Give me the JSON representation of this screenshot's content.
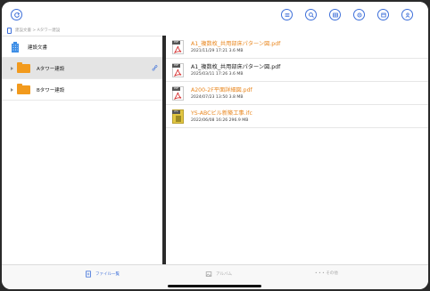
{
  "toolbar": {
    "left_button_icon": "refresh-icon",
    "right_buttons": [
      "list-icon",
      "search-icon",
      "grid-icon",
      "settings-icon",
      "window-icon",
      "user-icon"
    ],
    "accent": "#3d6fd9"
  },
  "breadcrumb": {
    "text": "建設文書 > Aタワー建設"
  },
  "tree": {
    "root": {
      "label": "建設文書",
      "icon": "building-icon"
    },
    "children": [
      {
        "label": "Aタワー建設",
        "selected": true,
        "linked": true
      },
      {
        "label": "Bタワー建設",
        "selected": false,
        "linked": false
      }
    ]
  },
  "files": [
    {
      "name": "A1_複数枚_共用部床パターン図.pdf",
      "meta": "2021/11/29 17:21  3.6 MB",
      "type": "pdf",
      "color": "#e9871f"
    },
    {
      "name": "A1_複数枚_共用部床パターン図.pdf",
      "meta": "2025/03/11 17:26  3.6 MB",
      "type": "pdf",
      "color": "#222222"
    },
    {
      "name": "A200-2F平面詳細図.pdf",
      "meta": "2024/07/23 13:50  3.8 MB",
      "type": "pdf",
      "color": "#e9871f"
    },
    {
      "name": "YS-ABCビル新築工事.ifc",
      "meta": "2022/06/08 16:26  296.9 MB",
      "type": "ifc",
      "color": "#e9871f"
    }
  ],
  "tabs": [
    {
      "label": "ファイル一覧",
      "active": true,
      "icon": "document-icon"
    },
    {
      "label": "アルバム",
      "active": false,
      "icon": "album-icon"
    },
    {
      "label": "• • • その他",
      "active": false,
      "icon": "more-icon"
    }
  ]
}
